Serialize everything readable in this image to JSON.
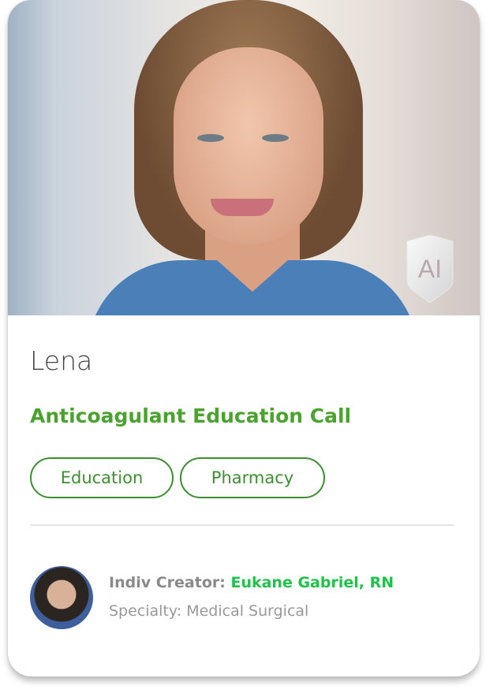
{
  "persona": {
    "name": "Lena",
    "ai_badge": "AI",
    "scenario_title": "Anticoagulant Education Call",
    "tags": [
      "Education",
      "Pharmacy"
    ]
  },
  "creator": {
    "label": "Indiv Creator:",
    "name": "Eukane Gabriel, RN",
    "specialty": "Specialty: Medical Surgical"
  },
  "colors": {
    "title": "#4aa32e",
    "tag_border": "#3f8d32",
    "creator_name": "#1fc24a"
  }
}
